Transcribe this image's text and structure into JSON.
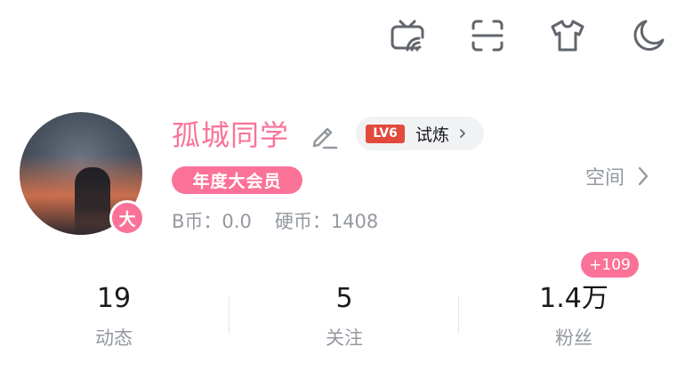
{
  "header": {
    "icons": [
      "tv-cast-icon",
      "scan-icon",
      "tshirt-icon",
      "moon-icon"
    ]
  },
  "profile": {
    "avatar_badge": "大",
    "username": "孤城同学",
    "level_badge": "LV6",
    "level_name": "试炼",
    "vip_label": "年度大会员",
    "b_coin_label": "B币：",
    "b_coin_value": "0.0",
    "hard_coin_label": "硬币：",
    "hard_coin_value": "1408",
    "space_label": "空间"
  },
  "stats": {
    "fans_new_badge": "+109",
    "items": [
      {
        "value": "19",
        "label": "动态"
      },
      {
        "value": "5",
        "label": "关注"
      },
      {
        "value": "1.4万",
        "label": "粉丝"
      }
    ]
  },
  "colors": {
    "brand_pink": "#fb7299",
    "level_red": "#e24a3c",
    "text_primary": "#18191c",
    "text_secondary": "#9499a0",
    "icon": "#61666d"
  }
}
